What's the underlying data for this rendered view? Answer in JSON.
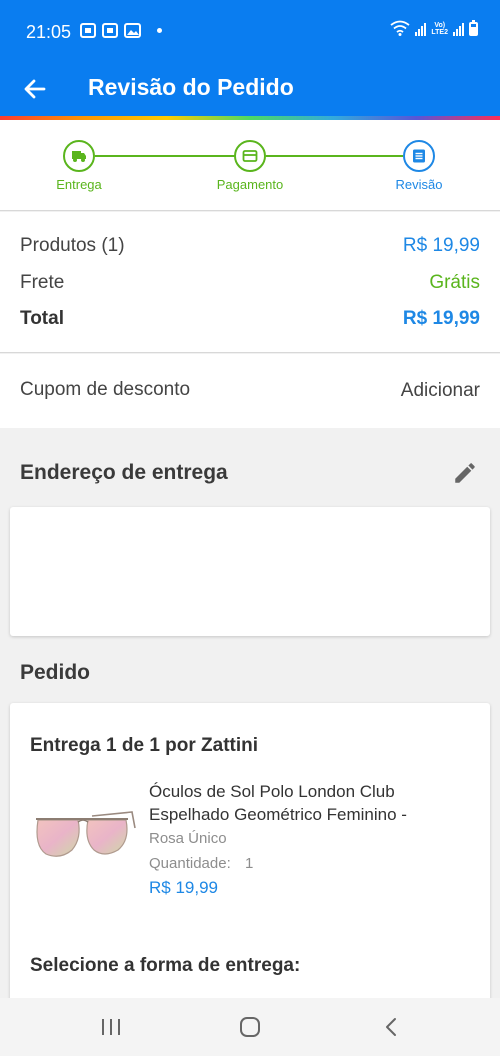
{
  "status_bar": {
    "time": "21:05",
    "icons": [
      "sim-icon",
      "sim-icon",
      "image-icon",
      "dot-icon"
    ],
    "network_label_top": "Vo)",
    "network_label_bottom": "LTE2"
  },
  "header": {
    "title": "Revisão do Pedido",
    "back_icon": "arrow-left-icon"
  },
  "colors": {
    "primary": "#0a7df0",
    "green": "#5ab51d",
    "price_blue": "#1e88e5"
  },
  "steps": [
    {
      "label": "Entrega",
      "icon": "truck-icon",
      "state": "done"
    },
    {
      "label": "Pagamento",
      "icon": "card-icon",
      "state": "done"
    },
    {
      "label": "Revisão",
      "icon": "list-icon",
      "state": "current"
    }
  ],
  "summary": {
    "products_label": "Produtos (1)",
    "products_value": "R$ 19,99",
    "shipping_label": "Frete",
    "shipping_value": "Grátis",
    "total_label": "Total",
    "total_value": "R$ 19,99"
  },
  "coupon": {
    "label": "Cupom de desconto",
    "action": "Adicionar"
  },
  "address": {
    "title": "Endereço de entrega",
    "edit_icon": "pencil-icon"
  },
  "order": {
    "title": "Pedido",
    "delivery_heading": "Entrega 1 de 1 por Zattini",
    "product": {
      "name_line1": "Óculos de Sol Polo London Club",
      "name_line2": "Espelhado Geométrico Feminino -",
      "variant": "Rosa Único",
      "quantity_label": "Quantidade:",
      "quantity_value": "1",
      "price": "R$ 19,99",
      "image_icon": "sunglasses-icon"
    },
    "shipping_prompt": "Selecione a forma de entrega:"
  },
  "nav_bar": {
    "icons": [
      "recent-apps-icon",
      "home-icon",
      "back-icon"
    ]
  }
}
